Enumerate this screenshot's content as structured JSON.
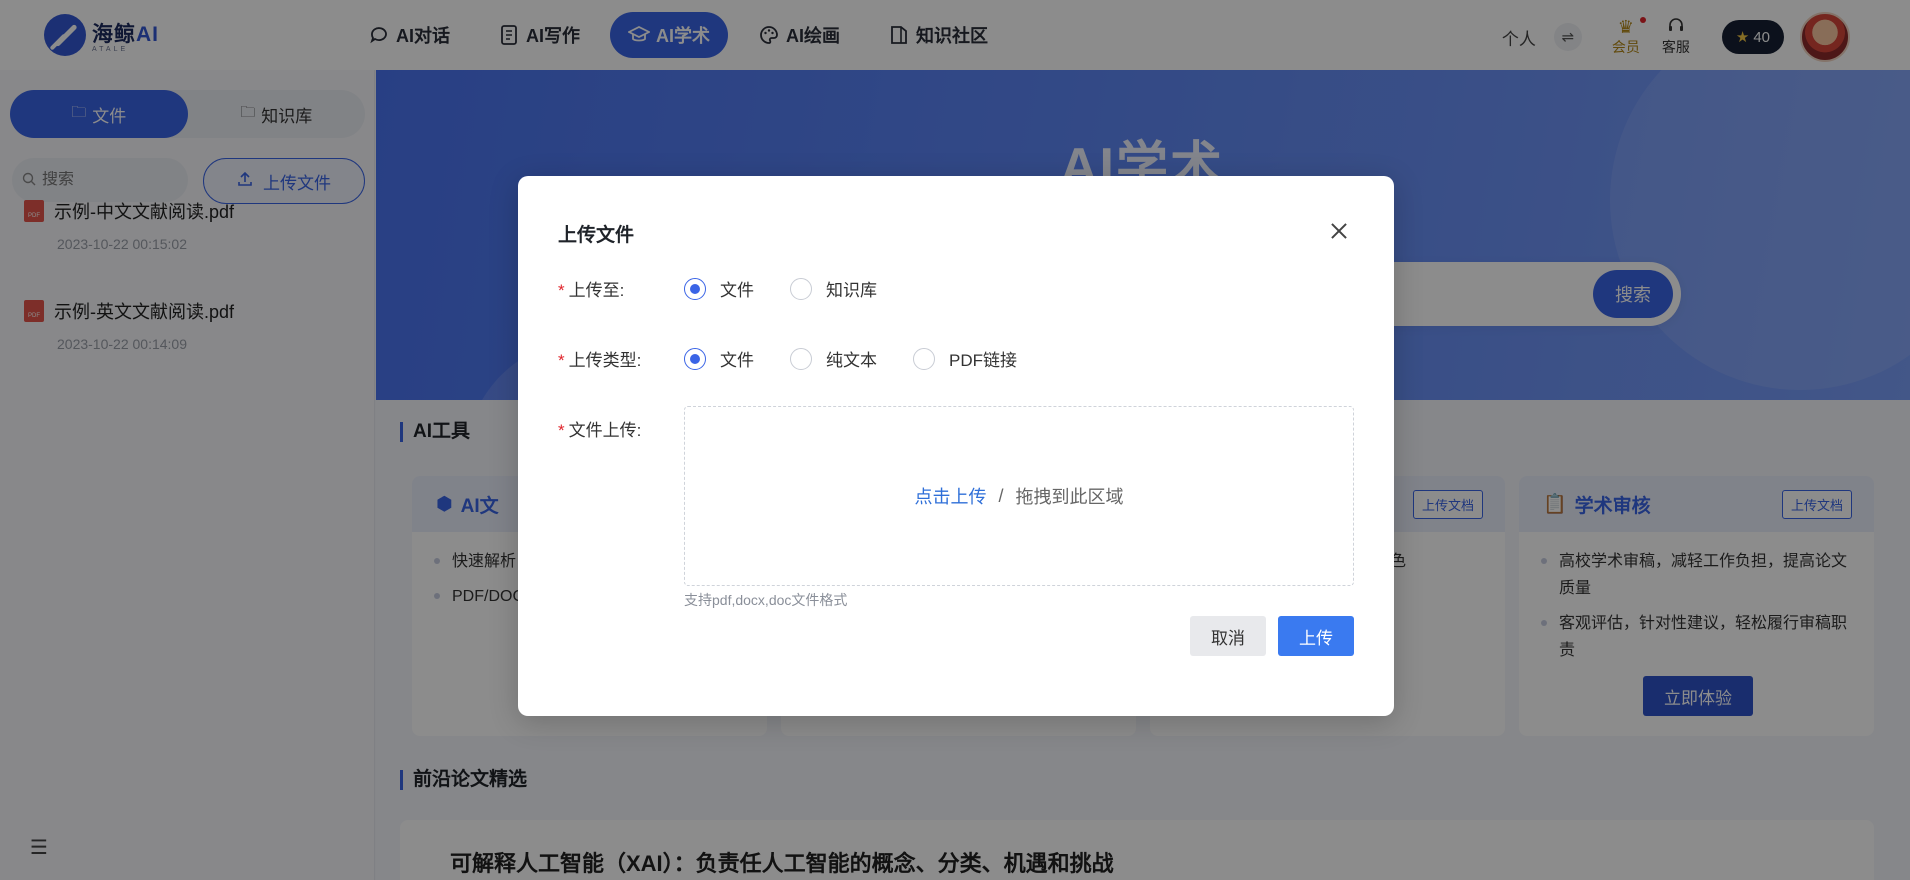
{
  "brand": {
    "name_cn": "海鲸",
    "name_ai": "AI",
    "tagline": "ATALE"
  },
  "nav": {
    "items": [
      {
        "label": "AI对话",
        "icon": "chat-icon"
      },
      {
        "label": "AI写作",
        "icon": "document-icon"
      },
      {
        "label": "AI学术",
        "icon": "graduation-cap-icon",
        "active": true
      },
      {
        "label": "AI绘画",
        "icon": "palette-icon"
      },
      {
        "label": "知识社区",
        "icon": "book-icon"
      }
    ]
  },
  "user": {
    "persona": "个人",
    "vip_label": "会员",
    "service_label": "客服",
    "coins": "40"
  },
  "sidebar": {
    "tabs": [
      {
        "label": "文件",
        "active": true
      },
      {
        "label": "知识库"
      }
    ],
    "search_placeholder": "搜索",
    "upload_label": "上传文件",
    "files": [
      {
        "name": "示例-中文文献阅读.pdf",
        "date": "2023-10-22 00:15:02"
      },
      {
        "name": "示例-英文文献阅读.pdf",
        "date": "2023-10-22 00:14:09"
      }
    ]
  },
  "main": {
    "hero_title": "AI学术",
    "hero_subtitle": "",
    "search_button": "搜索",
    "tools_title": "AI工具",
    "cards": [
      {
        "title": "AI文",
        "bullets": [
          "快速解析",
          "PDF/DOC"
        ],
        "tag": ""
      },
      {
        "title": "",
        "bullets": [],
        "tag": ""
      },
      {
        "title": "",
        "bullets": [
          "色"
        ],
        "tag": "上传文档"
      },
      {
        "title": "学术审核",
        "tag": "上传文档",
        "bullets": [
          "高校学术审稿，减轻工作负担，提高论文质量",
          "客观评估，针对性建议，轻松履行审稿职责"
        ],
        "cta": "立即体验"
      }
    ],
    "papers_title": "前沿论文精选",
    "paper_title": "可解释人工智能（XAI）：负责任人工智能的概念、分类、机遇和挑战"
  },
  "modal": {
    "title": "上传文件",
    "upload_to_label": "上传至:",
    "upload_to_options": [
      {
        "label": "文件",
        "checked": true
      },
      {
        "label": "知识库",
        "checked": false
      }
    ],
    "upload_type_label": "上传类型:",
    "upload_type_options": [
      {
        "label": "文件",
        "checked": true
      },
      {
        "label": "纯文本",
        "checked": false
      },
      {
        "label": "PDF链接",
        "checked": false
      }
    ],
    "file_upload_label": "文件上传:",
    "dropzone_click": "点击上传",
    "dropzone_sep": "/",
    "dropzone_drag": "拖拽到此区域",
    "hint": "支持pdf,docx,doc文件格式",
    "cancel_label": "取消",
    "confirm_label": "上传"
  },
  "colors": {
    "primary": "#3a64e6",
    "required": "#e0242b",
    "link": "#2f6fd8"
  }
}
